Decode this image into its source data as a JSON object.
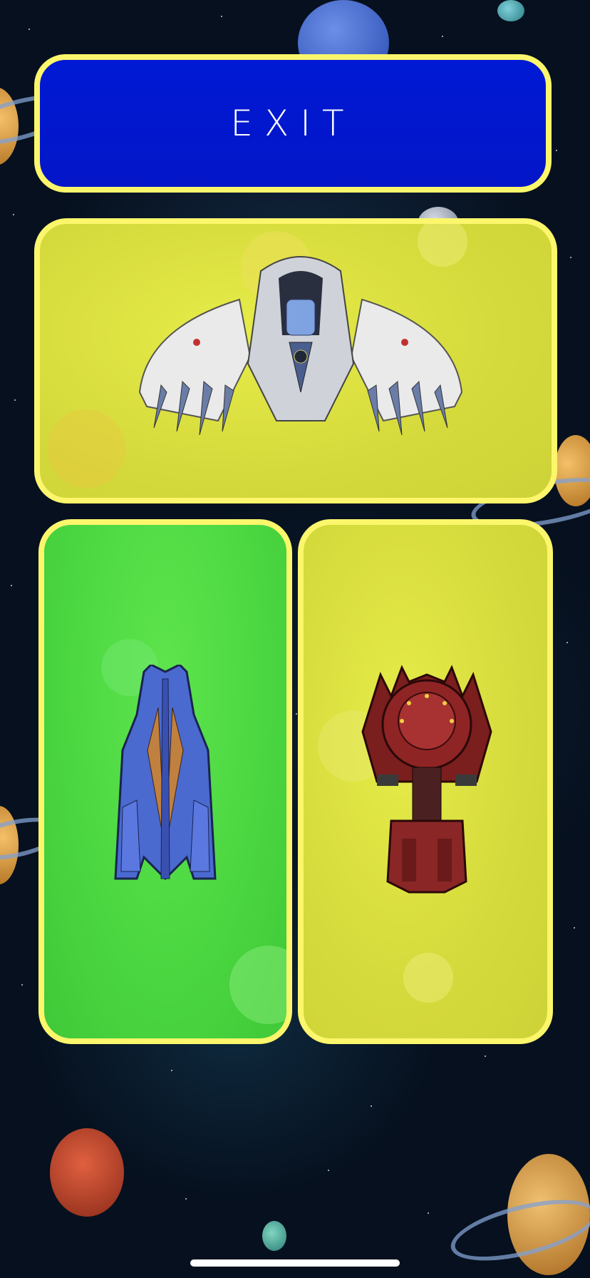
{
  "exit_button": {
    "label": "EXIT"
  },
  "colors": {
    "card_border": "#fbf66b",
    "exit_bg": "#0019d4",
    "card_yellow": "#d5da3c",
    "card_green": "#4ad640"
  },
  "ships": [
    {
      "name": "white-winged-fighter",
      "card_color": "yellow"
    },
    {
      "name": "blue-cruiser",
      "card_color": "green"
    },
    {
      "name": "red-orb-ship",
      "card_color": "yellow"
    }
  ]
}
